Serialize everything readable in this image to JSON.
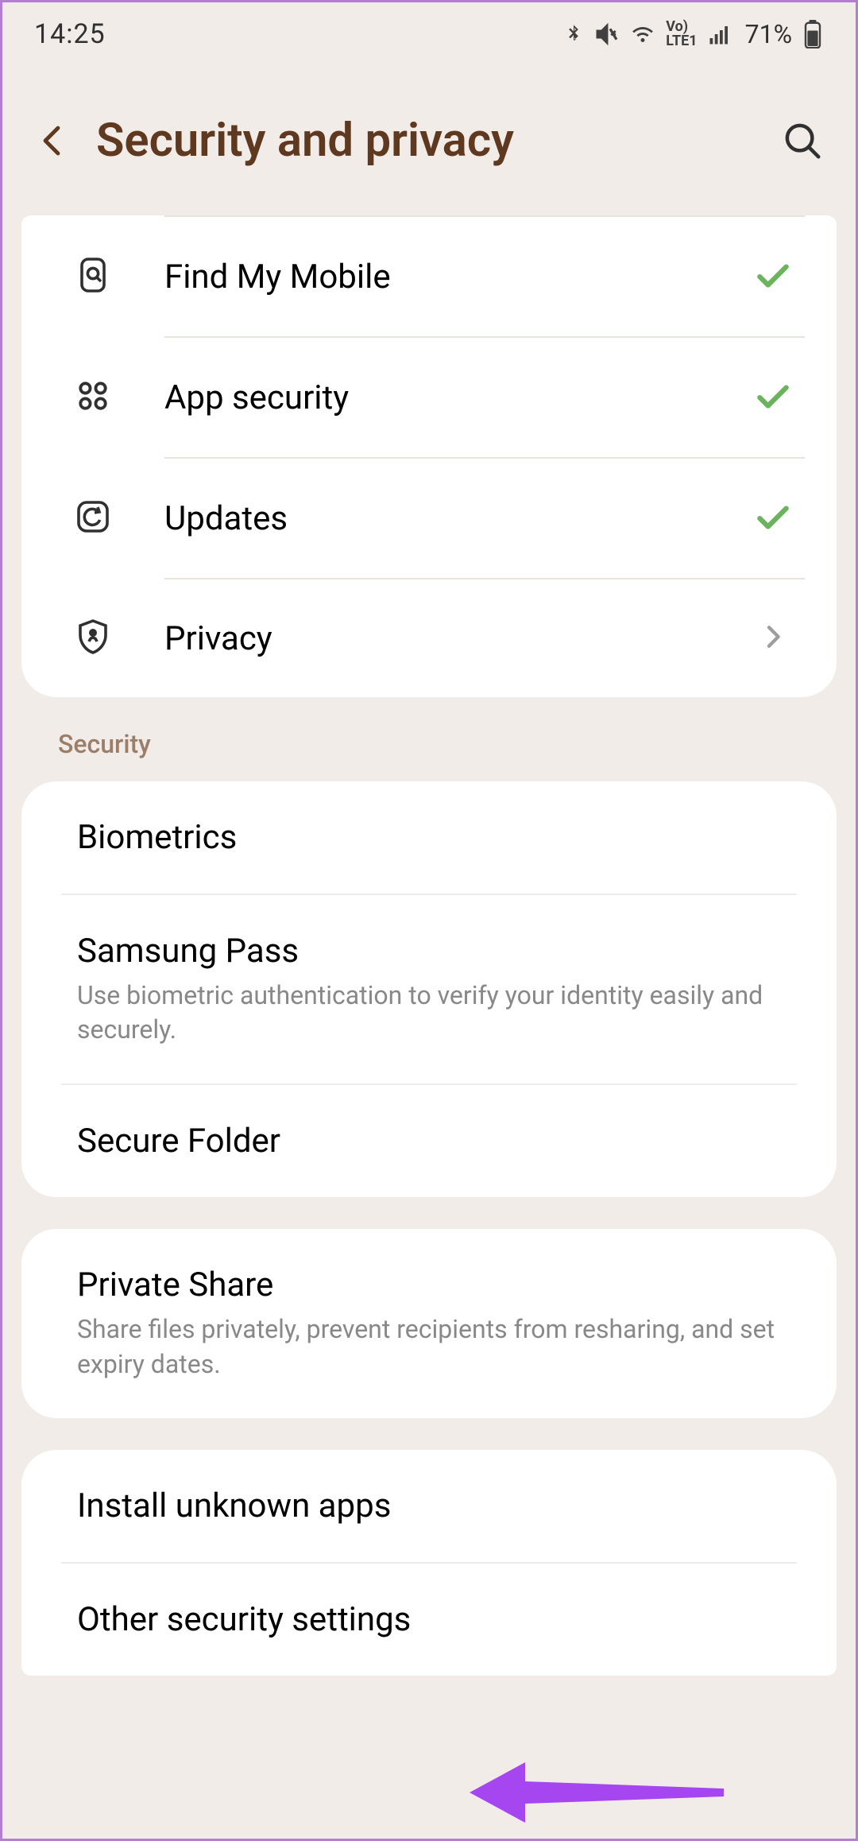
{
  "status_bar": {
    "time": "14:25",
    "battery": "71%"
  },
  "header": {
    "title": "Security and privacy"
  },
  "top_card": {
    "items": [
      {
        "label": "Find My Mobile",
        "status": "check"
      },
      {
        "label": "App security",
        "status": "check"
      },
      {
        "label": "Updates",
        "status": "check"
      },
      {
        "label": "Privacy",
        "status": "chevron"
      }
    ]
  },
  "section_security": "Security",
  "card_security": {
    "items": [
      {
        "label": "Biometrics",
        "sub": ""
      },
      {
        "label": "Samsung Pass",
        "sub": "Use biometric authentication to verify your identity easily and securely."
      },
      {
        "label": "Secure Folder",
        "sub": ""
      }
    ]
  },
  "card_share": {
    "items": [
      {
        "label": "Private Share",
        "sub": "Share files privately, prevent recipients from resharing, and set expiry dates."
      }
    ]
  },
  "card_other": {
    "items": [
      {
        "label": "Install unknown apps",
        "sub": ""
      },
      {
        "label": "Other security settings",
        "sub": ""
      }
    ]
  }
}
